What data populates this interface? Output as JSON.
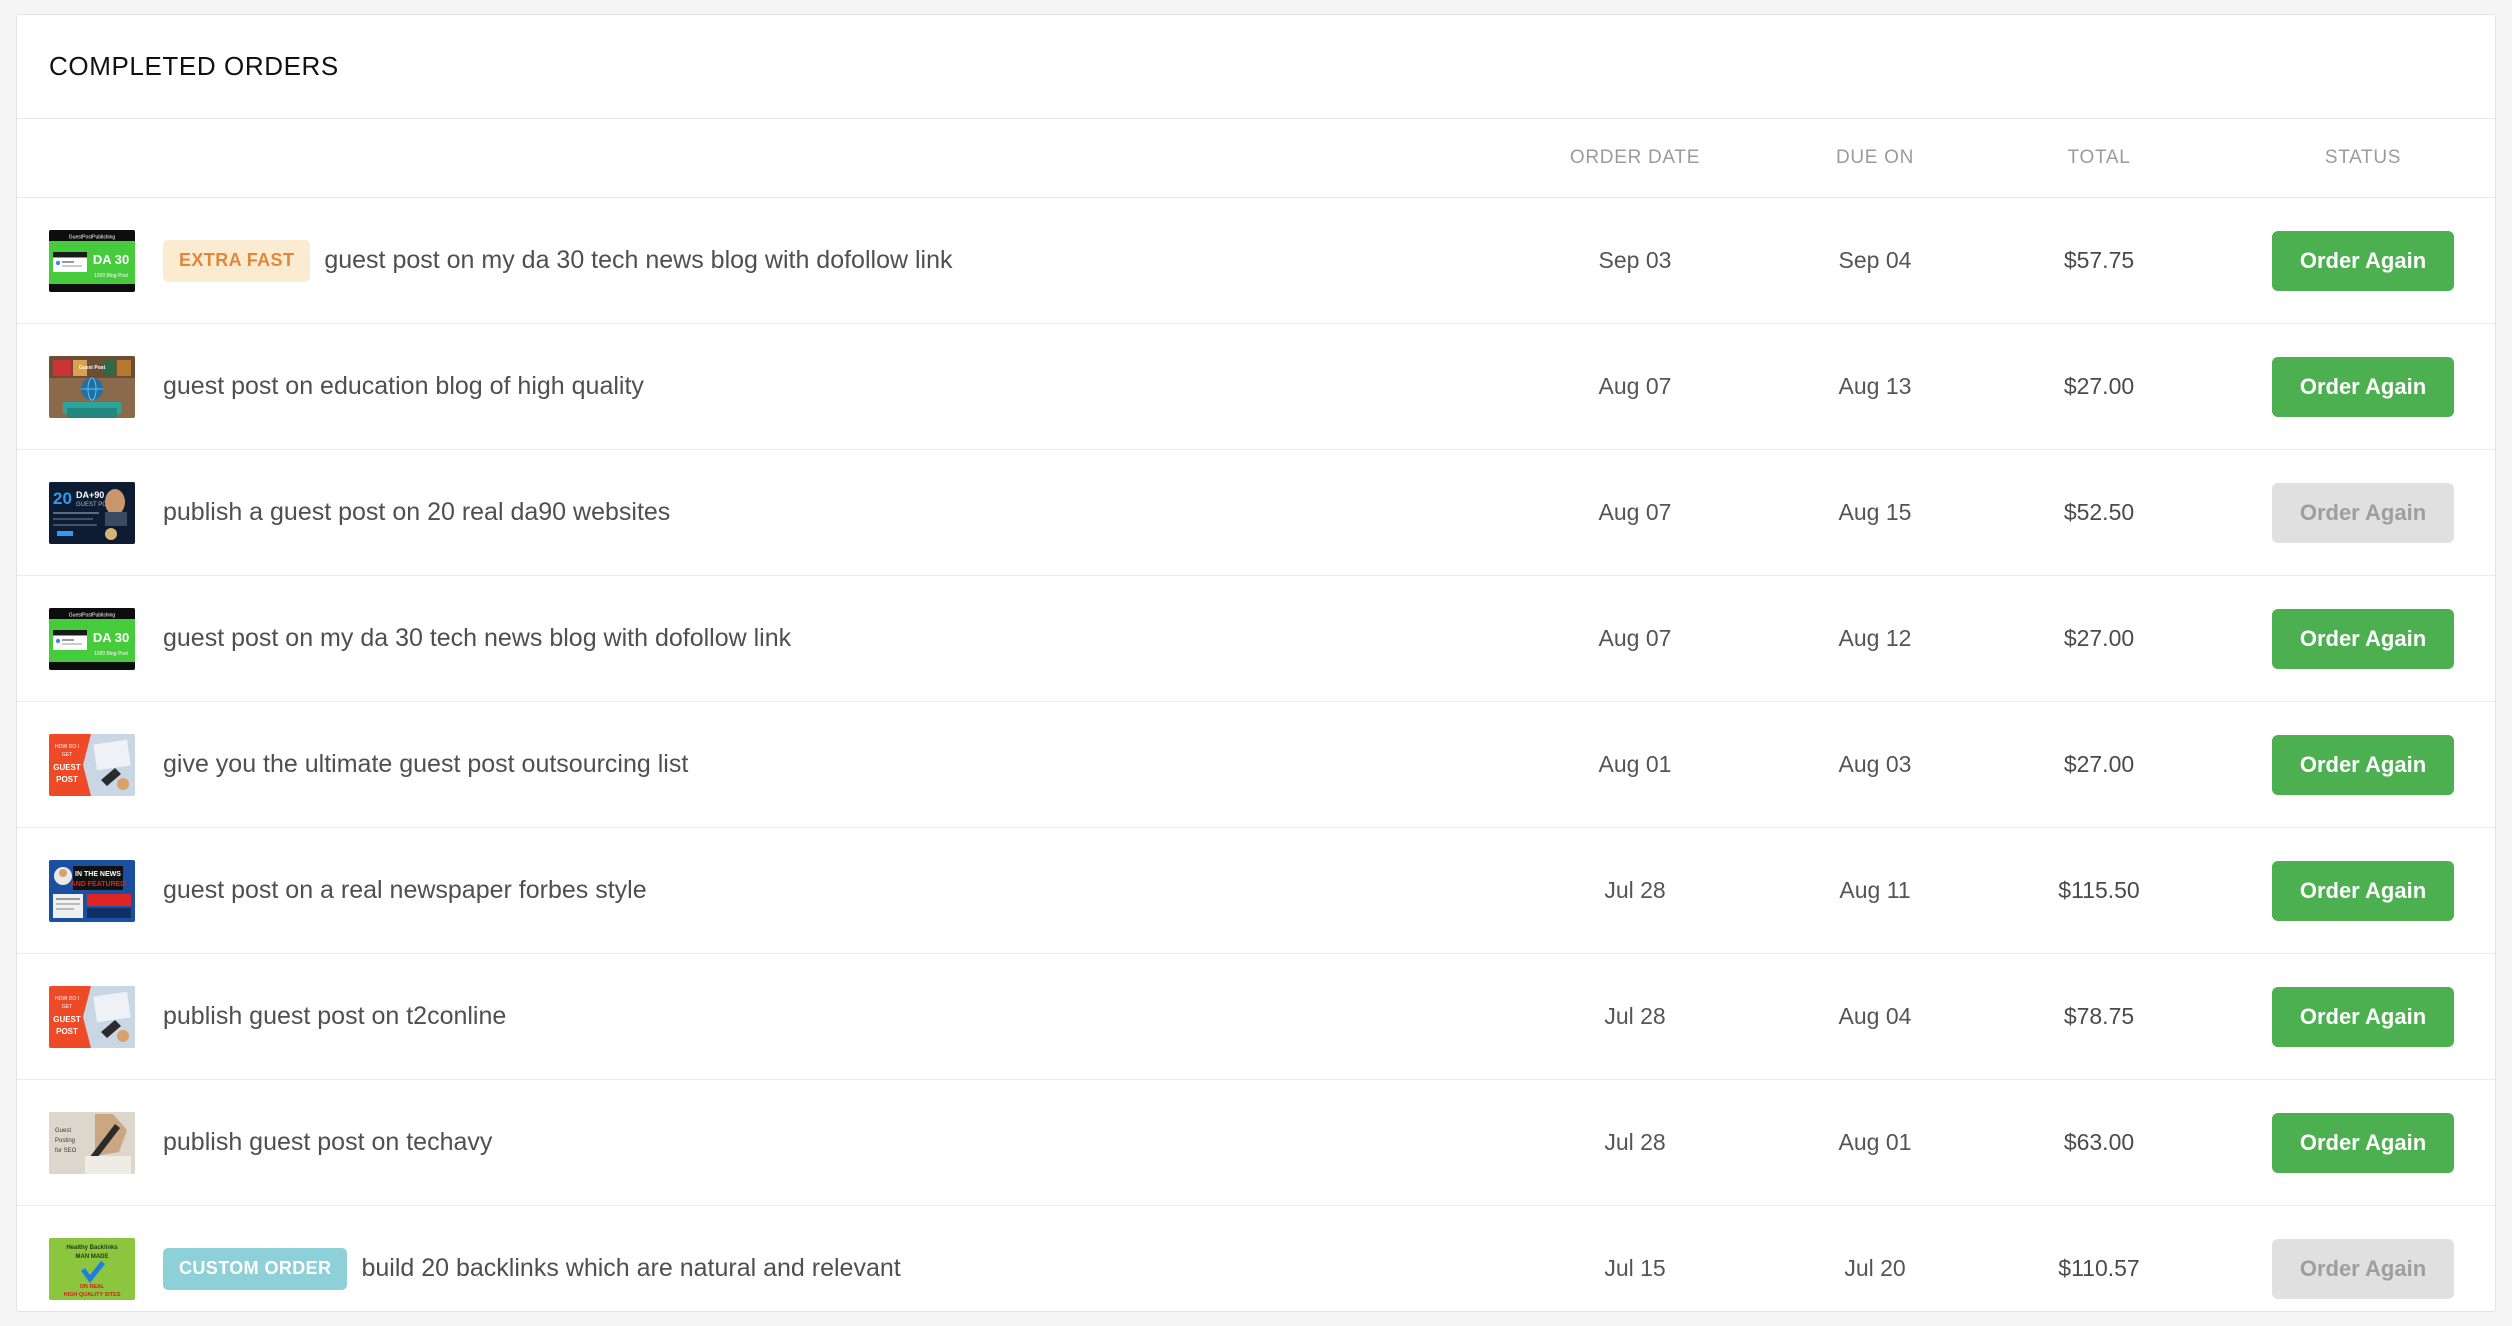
{
  "card": {
    "title": "COMPLETED ORDERS"
  },
  "table": {
    "headers": {
      "item": "",
      "order_date": "ORDER DATE",
      "due_on": "DUE ON",
      "total": "TOTAL",
      "status": "STATUS"
    },
    "rows": [
      {
        "thumb": "da30-green-thumbnail",
        "badge": "EXTRA FAST",
        "badge_type": "extra-fast",
        "title": "guest post on my da 30 tech news blog with dofollow link",
        "order_date": "Sep 03",
        "due_on": "Sep 04",
        "total": "$57.75",
        "action_label": "Order Again",
        "action_enabled": true
      },
      {
        "thumb": "education-globe-thumbnail",
        "badge": null,
        "badge_type": null,
        "title": "guest post on education blog of high quality",
        "order_date": "Aug 07",
        "due_on": "Aug 13",
        "total": "$27.00",
        "action_label": "Order Again",
        "action_enabled": true
      },
      {
        "thumb": "da90-blue-thumbnail",
        "badge": null,
        "badge_type": null,
        "title": "publish a guest post on 20 real da90 websites",
        "order_date": "Aug 07",
        "due_on": "Aug 15",
        "total": "$52.50",
        "action_label": "Order Again",
        "action_enabled": false
      },
      {
        "thumb": "da30-green-thumbnail",
        "badge": null,
        "badge_type": null,
        "title": "guest post on my da 30 tech news blog with dofollow link",
        "order_date": "Aug 07",
        "due_on": "Aug 12",
        "total": "$27.00",
        "action_label": "Order Again",
        "action_enabled": true
      },
      {
        "thumb": "red-guest-post-thumbnail",
        "badge": null,
        "badge_type": null,
        "title": "give you the ultimate guest post outsourcing list",
        "order_date": "Aug 01",
        "due_on": "Aug 03",
        "total": "$27.00",
        "action_label": "Order Again",
        "action_enabled": true
      },
      {
        "thumb": "newspaper-forbes-thumbnail",
        "badge": null,
        "badge_type": null,
        "title": "guest post on a real newspaper forbes style",
        "order_date": "Jul 28",
        "due_on": "Aug 11",
        "total": "$115.50",
        "action_label": "Order Again",
        "action_enabled": true
      },
      {
        "thumb": "red-guest-post-thumbnail",
        "badge": null,
        "badge_type": null,
        "title": "publish guest post on t2conline",
        "order_date": "Jul 28",
        "due_on": "Aug 04",
        "total": "$78.75",
        "action_label": "Order Again",
        "action_enabled": true
      },
      {
        "thumb": "writing-hand-thumbnail",
        "badge": null,
        "badge_type": null,
        "title": "publish guest post on techavy",
        "order_date": "Jul 28",
        "due_on": "Aug 01",
        "total": "$63.00",
        "action_label": "Order Again",
        "action_enabled": true
      },
      {
        "thumb": "healthy-backlinks-green-thumbnail",
        "badge": "CUSTOM ORDER",
        "badge_type": "custom-order",
        "title": "build 20 backlinks which are natural and relevant",
        "order_date": "Jul 15",
        "due_on": "Jul 20",
        "total": "$110.57",
        "action_label": "Order Again",
        "action_enabled": false
      }
    ]
  },
  "colors": {
    "accent_green": "#4caf50",
    "badge_extra_fast_bg": "#faebd1",
    "badge_extra_fast_fg": "#e2873a",
    "badge_custom_order_bg": "#8ed0d7",
    "page_bg": "#f5f5f5"
  }
}
